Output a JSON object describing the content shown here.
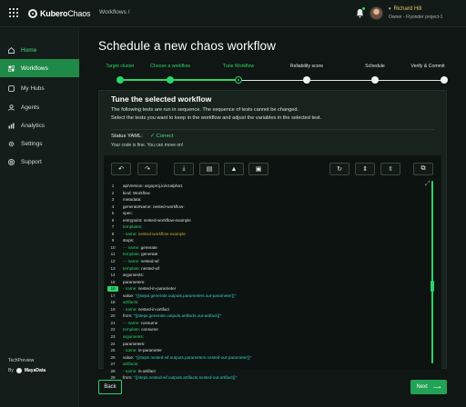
{
  "app": {
    "logo_brand": "Kubero",
    "logo_suffix": "Chaos"
  },
  "header": {
    "breadcrumb": "Workflows  /",
    "user": {
      "name": "Richard Hill",
      "role": "Owner - Flyonder project-1"
    }
  },
  "sidebar": {
    "items": [
      {
        "label": "Home",
        "icon": "home-icon"
      },
      {
        "label": "Workflows",
        "icon": "workflow-icon",
        "active": true
      },
      {
        "label": "My Hubs",
        "icon": "hub-icon"
      },
      {
        "label": "Agents",
        "icon": "agent-icon"
      },
      {
        "label": "Analytics",
        "icon": "analytics-icon"
      },
      {
        "label": "Settings",
        "icon": "gear-icon"
      },
      {
        "label": "Support",
        "icon": "support-icon"
      }
    ],
    "footer_line1": "TechPreview",
    "footer_by": "By",
    "footer_company": "MayaData"
  },
  "page": {
    "title": "Schedule a new chaos workflow"
  },
  "stepper": {
    "steps": [
      {
        "label": "Target cluster",
        "state": "done"
      },
      {
        "label": "Choose a workflow",
        "state": "done"
      },
      {
        "label": "Tune Workflow",
        "state": "current"
      },
      {
        "label": "Reliability score",
        "state": "todo"
      },
      {
        "label": "Schedule",
        "state": "todo"
      },
      {
        "label": "Verify & Commit",
        "state": "todo"
      }
    ]
  },
  "panel": {
    "title": "Tune the selected workflow",
    "desc1": "The following tests are run in sequence. The sequence of tests cannot be changed.",
    "desc2": "Select the tests you want to keep in the workflow and adjust the variables in the selected test.",
    "status_label": "Status YAML:",
    "status_value": "✓  Correct",
    "status_msg": "Your code is fine. You can move on!"
  },
  "editor": {
    "toolbar": [
      "↶",
      "↷",
      "⤓",
      "▤",
      "▲",
      "▣",
      "↻",
      "⇕",
      "⇳",
      "⧉"
    ],
    "expand_icon": "⤢",
    "lines": [
      {
        "n": "1",
        "parts": [
          [
            "k",
            "apiVersion: argoproj.io/v1alpha1"
          ]
        ]
      },
      {
        "n": "2",
        "parts": [
          [
            "k",
            "kind: Workflow"
          ]
        ]
      },
      {
        "n": "3",
        "parts": [
          [
            "k",
            "metadata:"
          ]
        ]
      },
      {
        "n": "4",
        "parts": [
          [
            "k",
            "   generateName: nested-workflow-"
          ]
        ]
      },
      {
        "n": "5",
        "parts": [
          [
            "k",
            "spec:"
          ]
        ]
      },
      {
        "n": "6",
        "parts": [
          [
            "k",
            "   entrypoint: nested-workflow-example"
          ]
        ]
      },
      {
        "n": "7",
        "parts": [
          [
            "g",
            "   templates:"
          ]
        ]
      },
      {
        "n": "8",
        "parts": [
          [
            "g",
            "   - name: "
          ],
          [
            "y",
            "nested-workflow-example"
          ]
        ]
      },
      {
        "n": "9",
        "parts": [
          [
            "k",
            "      steps:"
          ]
        ]
      },
      {
        "n": "10",
        "parts": [
          [
            "g",
            "      - - name: "
          ],
          [
            "k",
            "generate"
          ]
        ]
      },
      {
        "n": "11",
        "parts": [
          [
            "g",
            "         template: "
          ],
          [
            "k",
            "generate"
          ]
        ]
      },
      {
        "n": "12",
        "parts": [
          [
            "g",
            "      - - name: "
          ],
          [
            "k",
            "nested-wf"
          ]
        ]
      },
      {
        "n": "13",
        "parts": [
          [
            "g",
            "         template: "
          ],
          [
            "k",
            "nested-wf"
          ]
        ]
      },
      {
        "n": "14",
        "parts": [
          [
            "k",
            "         arguments:"
          ]
        ]
      },
      {
        "n": "15",
        "parts": [
          [
            "k",
            "            parameters:"
          ]
        ]
      },
      {
        "n": "16",
        "hl": true,
        "parts": [
          [
            "g",
            "            - name: "
          ],
          [
            "k",
            "nested-in-parameter"
          ]
        ]
      },
      {
        "n": "17",
        "parts": [
          [
            "k",
            "               value: "
          ],
          [
            "c",
            "\"{{steps.generate.outputs.parameters.out-parameter}}\""
          ]
        ]
      },
      {
        "n": "18",
        "parts": [
          [
            "g",
            "            artifacts:"
          ]
        ]
      },
      {
        "n": "19",
        "parts": [
          [
            "g",
            "            - name: "
          ],
          [
            "k",
            "nested-in-artifact"
          ]
        ]
      },
      {
        "n": "20",
        "parts": [
          [
            "k",
            "               from: "
          ],
          [
            "c",
            "\"{{steps.generate.outputs.artifacts.out-artifact}}\""
          ]
        ]
      },
      {
        "n": "21",
        "parts": [
          [
            "g",
            "      - - name: "
          ],
          [
            "k",
            "consume"
          ]
        ]
      },
      {
        "n": "22",
        "parts": [
          [
            "g",
            "         template: "
          ],
          [
            "k",
            "consume"
          ]
        ]
      },
      {
        "n": "23",
        "parts": [
          [
            "g",
            "         arguments:"
          ]
        ]
      },
      {
        "n": "24",
        "parts": [
          [
            "k",
            "            parameters:"
          ]
        ]
      },
      {
        "n": "25",
        "parts": [
          [
            "g",
            "            - name: "
          ],
          [
            "k",
            "in-parameter"
          ]
        ]
      },
      {
        "n": "26",
        "parts": [
          [
            "k",
            "               value: "
          ],
          [
            "c",
            "\"{{steps.nested-wf.outputs.parameters.nested-out-parameter}}\""
          ]
        ]
      },
      {
        "n": "27",
        "parts": [
          [
            "g",
            "            artifacts:"
          ]
        ]
      },
      {
        "n": "28",
        "parts": [
          [
            "g",
            "            - name: "
          ],
          [
            "k",
            "in-artifact"
          ]
        ]
      },
      {
        "n": "29",
        "parts": [
          [
            "k",
            "               from: "
          ],
          [
            "c",
            "\"{{steps.nested-wf.outputs.artifacts.nested-out-artifact}}\""
          ]
        ]
      }
    ]
  },
  "footer": {
    "back_label": "Back",
    "next_label": "Next",
    "next_arrow": "⟶"
  }
}
